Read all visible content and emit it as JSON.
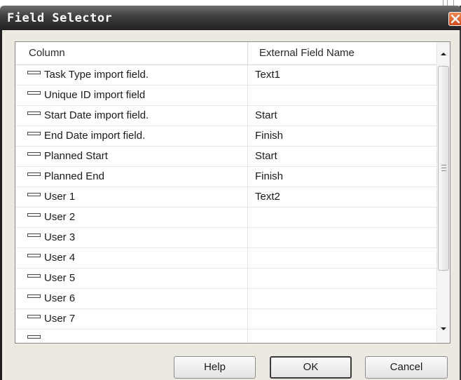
{
  "window": {
    "title": "Field Selector"
  },
  "grid": {
    "columns": [
      "Column",
      "External Field Name"
    ],
    "rows": [
      {
        "column": "Task Type import field.",
        "external": "Text1"
      },
      {
        "column": "Unique ID import field",
        "external": ""
      },
      {
        "column": "Start Date import field.",
        "external": "Start"
      },
      {
        "column": "End Date import field.",
        "external": "Finish"
      },
      {
        "column": "Planned Start",
        "external": "Start"
      },
      {
        "column": "Planned End",
        "external": "Finish"
      },
      {
        "column": "User 1",
        "external": "Text2"
      },
      {
        "column": "User 2",
        "external": ""
      },
      {
        "column": "User 3",
        "external": ""
      },
      {
        "column": "User 4",
        "external": ""
      },
      {
        "column": "User 5",
        "external": ""
      },
      {
        "column": "User 6",
        "external": ""
      },
      {
        "column": "User 7",
        "external": ""
      },
      {
        "column": "",
        "external": ""
      }
    ]
  },
  "buttons": {
    "help": "Help",
    "ok": "OK",
    "cancel": "Cancel"
  },
  "icons": {
    "close": "close-icon",
    "row": "field-icon",
    "scroll_up": "chevron-up-icon",
    "scroll_down": "chevron-down-icon"
  },
  "colors": {
    "titlebar": "#3e3e3e",
    "close_button": "#e06a30",
    "dialog_bg": "#ece9e1"
  }
}
